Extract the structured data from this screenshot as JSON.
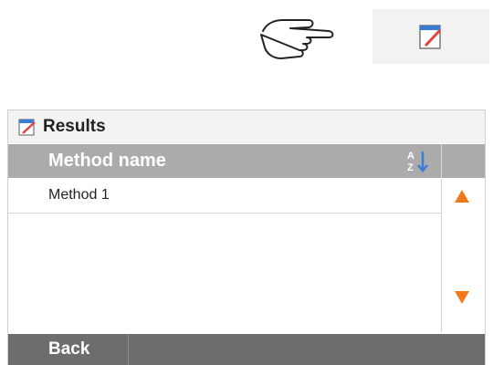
{
  "illustration": {
    "hand_icon": "pointing-hand-icon",
    "target_button_icon": "results-edit-icon"
  },
  "panel": {
    "title": "Results",
    "title_icon": "results-edit-icon"
  },
  "table": {
    "column_header": "Method name",
    "sort_icon": "sort-az-icon",
    "rows": [
      "Method 1"
    ]
  },
  "scroll": {
    "up_icon": "scroll-up-arrow-icon",
    "down_icon": "scroll-down-arrow-icon"
  },
  "footer": {
    "back_label": "Back"
  },
  "colors": {
    "accent_orange": "#f07a1a",
    "header_gray": "#ababab",
    "footer_gray": "#6d6d6d",
    "sort_blue": "#3a7bd5",
    "icon_red": "#e0443c"
  }
}
